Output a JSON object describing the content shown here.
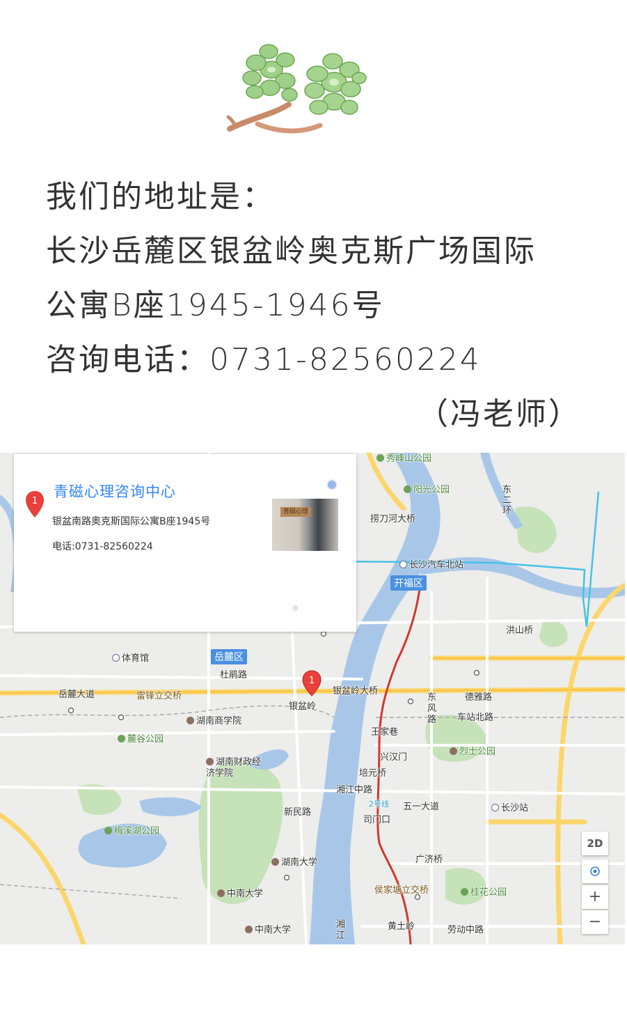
{
  "intro": {
    "line1": "我们的地址是：",
    "line2": "长沙岳麓区银盆岭奥克斯广场国际",
    "line3": "公寓B座1945-1946号",
    "line4": "咨询电话：0731-82560224",
    "line5": "（冯老师）"
  },
  "map": {
    "card": {
      "marker": "1",
      "title": "青磁心理咨询中心",
      "address": "银盆南路奥克斯国际公寓B座1945号",
      "phone": "电话:0731-82560224",
      "photo_sign": "青磁心理"
    },
    "marker_label": "1",
    "districts": {
      "yuelu": "岳麓区",
      "kaifu": "开福区"
    },
    "labels": {
      "xiufeng": "秀峰山公园",
      "yangguang": "阳光公园",
      "laodaohe": "捞刀河大桥",
      "bus_north": "长沙汽车北站",
      "dong2": "东二环",
      "hongshan": "洪山桥",
      "tiyuguan": "体育馆",
      "dujuan": "杜鹃路",
      "yinpenling_bridge": "银盆岭大桥",
      "yuelu_ave": "岳麓大道",
      "leifeng": "雷锋立交桥",
      "yinpenling": "银盆岭",
      "shangxue": "湖南商学院",
      "dongfeng": "东风路",
      "deya": "德雅路",
      "czbl": "车站北路",
      "wangjiaxiang": "王家巷",
      "lugu": "麓谷公园",
      "caizheng": "湖南财政经济学院",
      "xinghanmen": "兴汉门",
      "lieshi": "烈士公园",
      "peiyuan": "培元桥",
      "xiangjiang_mid": "湘江中路",
      "xinmin": "新民路",
      "line2": "2号线",
      "wuyi": "五一大道",
      "changsha_station": "长沙站",
      "simen": "司门口",
      "meixi": "梅溪湖公园",
      "hnu": "湖南大学",
      "guangji": "广济桥",
      "houjia": "侯家塘立交桥",
      "guihua": "桂花公园",
      "csu1": "中南大学",
      "huangtu": "黄土岭",
      "csu2": "中南大学",
      "laodong": "劳动中路",
      "xiang": "湘江"
    },
    "controls": {
      "twod": "2D",
      "zoom_in": "+",
      "zoom_out": "−"
    },
    "colors": {
      "water": "#a8c7e8",
      "park": "#bfe0b4",
      "road_major": "#fbd66b",
      "metro_red": "#d2372b",
      "metro_blue": "#45c2e6",
      "accent": "#3385ff"
    }
  }
}
